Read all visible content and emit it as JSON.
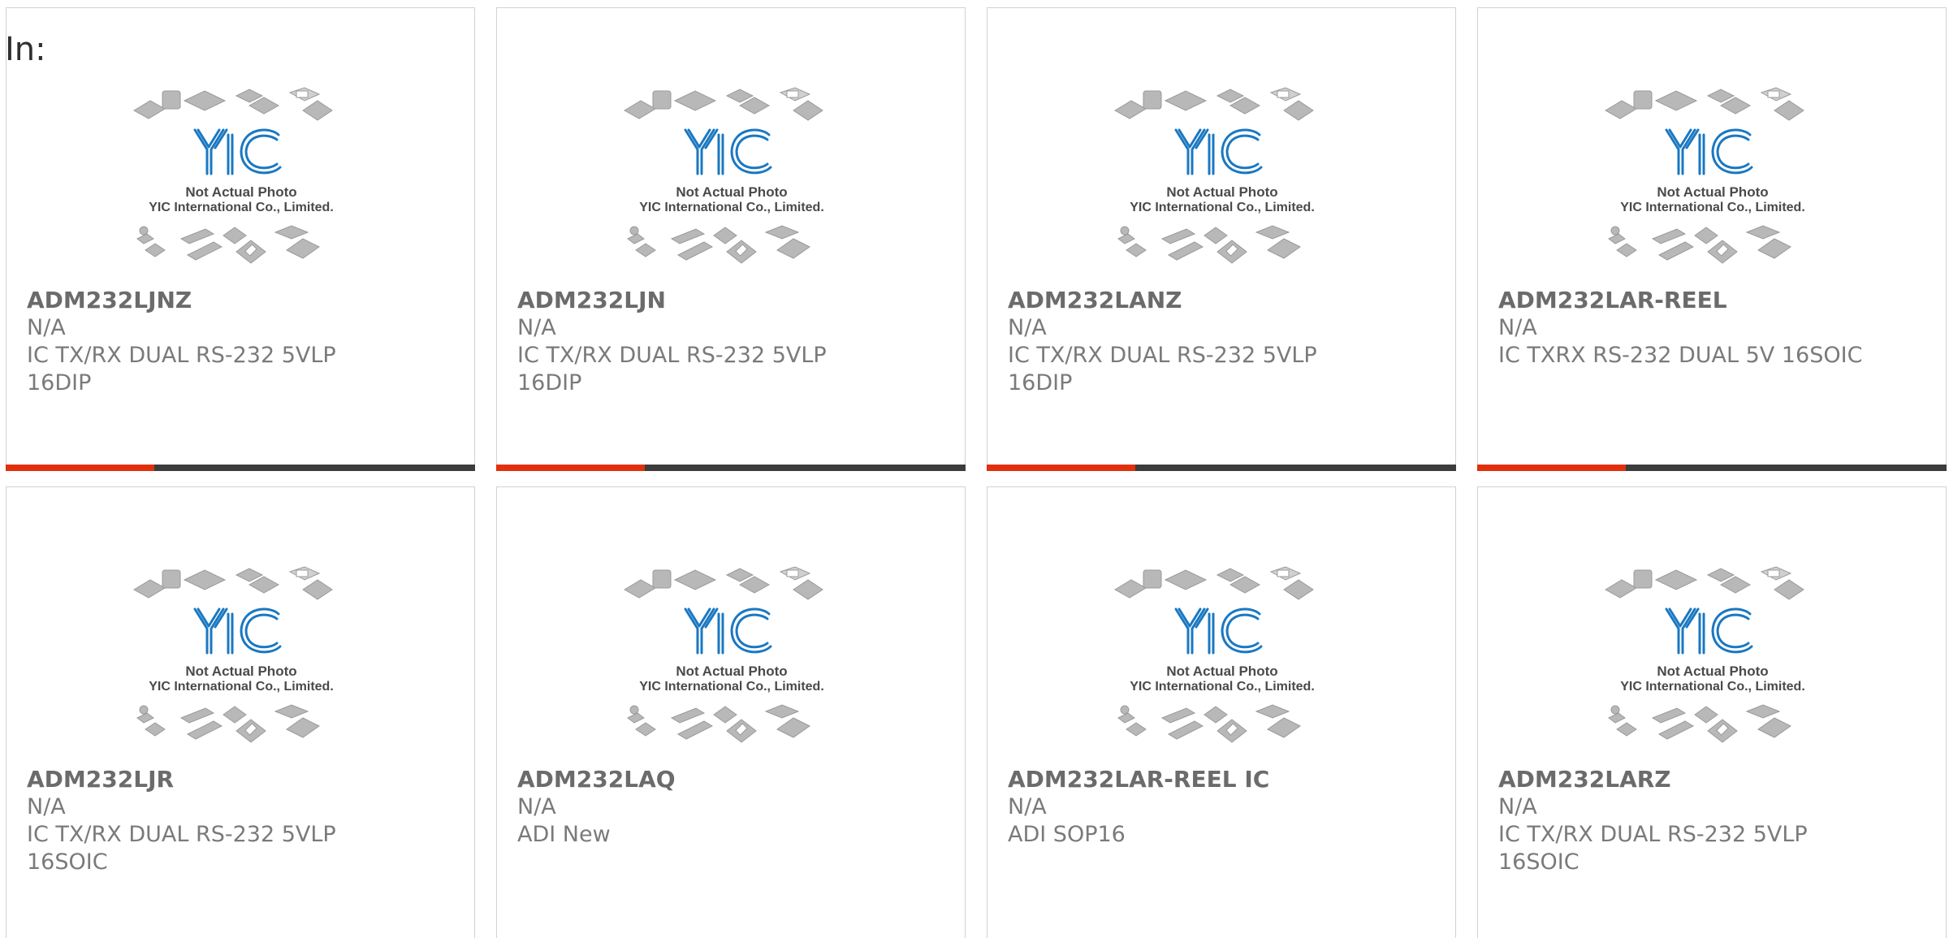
{
  "prefix": "In:",
  "watermark": {
    "logo_text": "YIC",
    "line1": "Not Actual Photo",
    "line2": "YIC International Co., Limited."
  },
  "colors": {
    "accent": "#e0300e",
    "bar": "#3c3c3c",
    "logo": "#1a78c2",
    "text": "#7a7a7a"
  },
  "cards": [
    {
      "part": "ADM232LJNZ",
      "brand": "N/A",
      "desc": "IC TX/RX DUAL RS-232 5VLP",
      "desc2": "16DIP"
    },
    {
      "part": "ADM232LJN",
      "brand": "N/A",
      "desc": "IC TX/RX DUAL RS-232 5VLP",
      "desc2": "16DIP"
    },
    {
      "part": "ADM232LANZ",
      "brand": "N/A",
      "desc": "IC TX/RX DUAL RS-232 5VLP",
      "desc2": "16DIP"
    },
    {
      "part": "ADM232LAR-REEL",
      "brand": "N/A",
      "desc": "IC TXRX RS-232 DUAL 5V 16SOIC",
      "desc2": ""
    },
    {
      "part": "ADM232LJR",
      "brand": "N/A",
      "desc": "IC TX/RX DUAL RS-232 5VLP",
      "desc2": "16SOIC"
    },
    {
      "part": "ADM232LAQ",
      "brand": "N/A",
      "desc": "ADI New",
      "desc2": ""
    },
    {
      "part": "ADM232LAR-REEL IC",
      "brand": "N/A",
      "desc": "ADI SOP16",
      "desc2": ""
    },
    {
      "part": "ADM232LARZ",
      "brand": "N/A",
      "desc": "IC TX/RX DUAL RS-232 5VLP",
      "desc2": "16SOIC"
    }
  ]
}
